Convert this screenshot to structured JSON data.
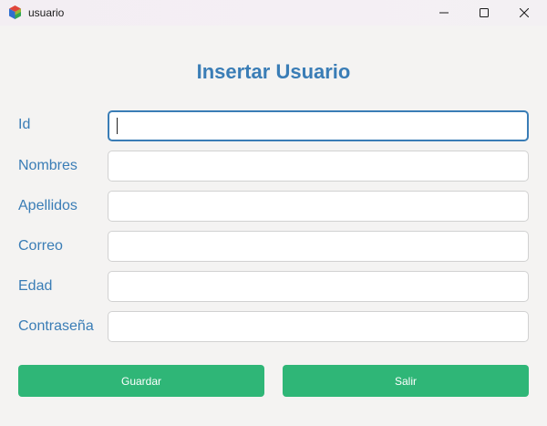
{
  "window": {
    "title": "usuario",
    "icon": "app-cube-icon",
    "controls": [
      "minimize-icon",
      "maximize-icon",
      "close-icon"
    ]
  },
  "form": {
    "heading": "Insertar Usuario",
    "fields": [
      {
        "label": "Id",
        "value": "",
        "focused": true
      },
      {
        "label": "Nombres",
        "value": ""
      },
      {
        "label": "Apellidos",
        "value": ""
      },
      {
        "label": "Correo",
        "value": ""
      },
      {
        "label": "Edad",
        "value": ""
      },
      {
        "label": "Contraseña",
        "value": ""
      }
    ]
  },
  "buttons": {
    "save_label": "Guardar",
    "exit_label": "Salir"
  },
  "colors": {
    "accent": "#3a7db6",
    "button": "#2fb677",
    "background": "#f4f3f2"
  }
}
